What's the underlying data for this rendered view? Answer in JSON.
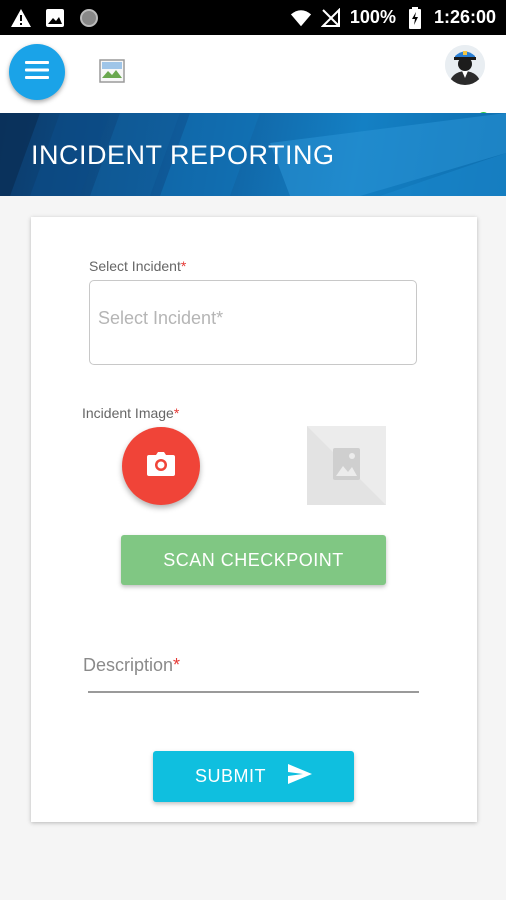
{
  "status_bar": {
    "battery": "100%",
    "time": "1:26:00"
  },
  "header": {
    "title": "INCIDENT REPORTING"
  },
  "form": {
    "select_incident_label": "Select Incident",
    "select_incident_placeholder": "Select Incident*",
    "incident_image_label": "Incident Image",
    "required_marker": "*",
    "scan_checkpoint_label": "SCAN CHECKPOINT",
    "description_label": "Description",
    "submit_label": "SUBMIT"
  },
  "colors": {
    "menu_fab": "#1aa3e8",
    "camera_button": "#f04438",
    "scan_button": "#80c783",
    "submit_button": "#0fbfdf",
    "required": "#e53935",
    "online": "#2ecc40"
  },
  "icons": {
    "menu": "hamburger-icon",
    "camera": "camera-icon",
    "image_placeholder": "image-icon",
    "send": "send-icon",
    "logo": "broken-image-icon",
    "avatar": "user-avatar"
  }
}
